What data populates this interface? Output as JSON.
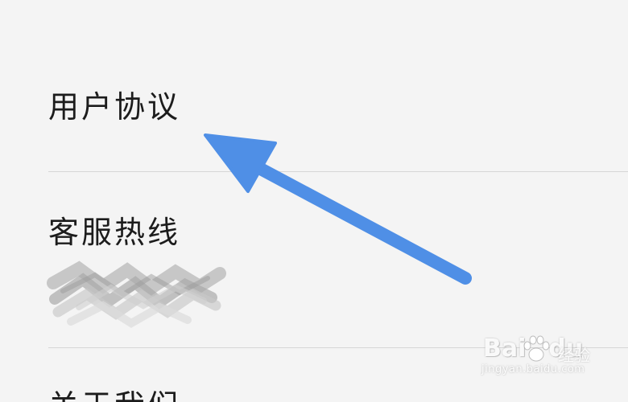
{
  "settings": {
    "items": [
      {
        "label": "用户协议"
      },
      {
        "label": "客服热线",
        "value_redacted": true
      },
      {
        "label": "关于我们"
      }
    ]
  },
  "annotation": {
    "arrow_color": "#4f8fe6",
    "arrow_target": "用户协议"
  },
  "watermark": {
    "logo": "Bai",
    "logo_suffix": "du",
    "name": "经验",
    "url": "jingyan.baidu.com"
  },
  "colors": {
    "background": "#f4f4f4",
    "divider": "#d6d6d6",
    "text": "#1c1c1c",
    "arrow": "#4f8fe6"
  }
}
